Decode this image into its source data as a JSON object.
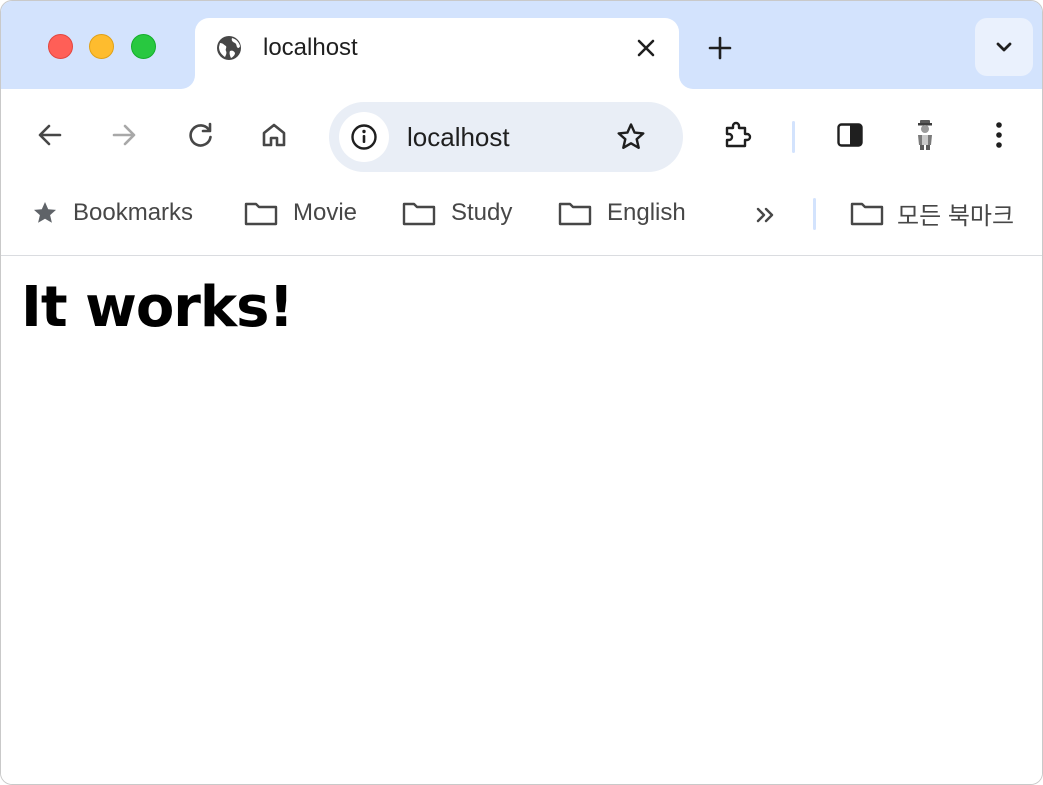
{
  "window": {
    "traffic_lights": {
      "close": "close-window-button",
      "minimize": "minimize-window-button",
      "zoom": "zoom-window-button"
    }
  },
  "tab": {
    "title": "localhost",
    "favicon": "globe-icon",
    "close_icon": "close-icon"
  },
  "tabstrip": {
    "new_tab_icon": "plus-icon",
    "tab_search_icon": "chevron-down-icon"
  },
  "toolbar": {
    "back_icon": "arrow-left-icon",
    "forward_icon": "arrow-right-icon",
    "reload_icon": "reload-icon",
    "home_icon": "home-icon",
    "extensions_icon": "puzzle-icon",
    "side_panel_icon": "side-panel-icon",
    "profile_icon": "avatar",
    "menu_icon": "kebab-menu-icon"
  },
  "omnibox": {
    "url": "localhost",
    "site_info_icon": "info-icon",
    "bookmark_star_icon": "star-outline-icon"
  },
  "bookmarks_bar": {
    "items": [
      {
        "label": "Bookmarks",
        "icon": "star-filled-icon"
      },
      {
        "label": "Movie",
        "icon": "folder-icon"
      },
      {
        "label": "Study",
        "icon": "folder-icon"
      },
      {
        "label": "English",
        "icon": "folder-icon"
      }
    ],
    "overflow_icon": "double-chevron-right-icon",
    "all_bookmarks": {
      "label": "모든 북마크",
      "icon": "folder-icon"
    }
  },
  "page": {
    "heading": "It works!"
  },
  "colors": {
    "tabstrip_bg": "#d3e3fd",
    "omnibox_bg": "#e9eef6",
    "icon": "#474747",
    "icon_disabled": "#a8a8a8",
    "text": "#1f1f1f"
  }
}
